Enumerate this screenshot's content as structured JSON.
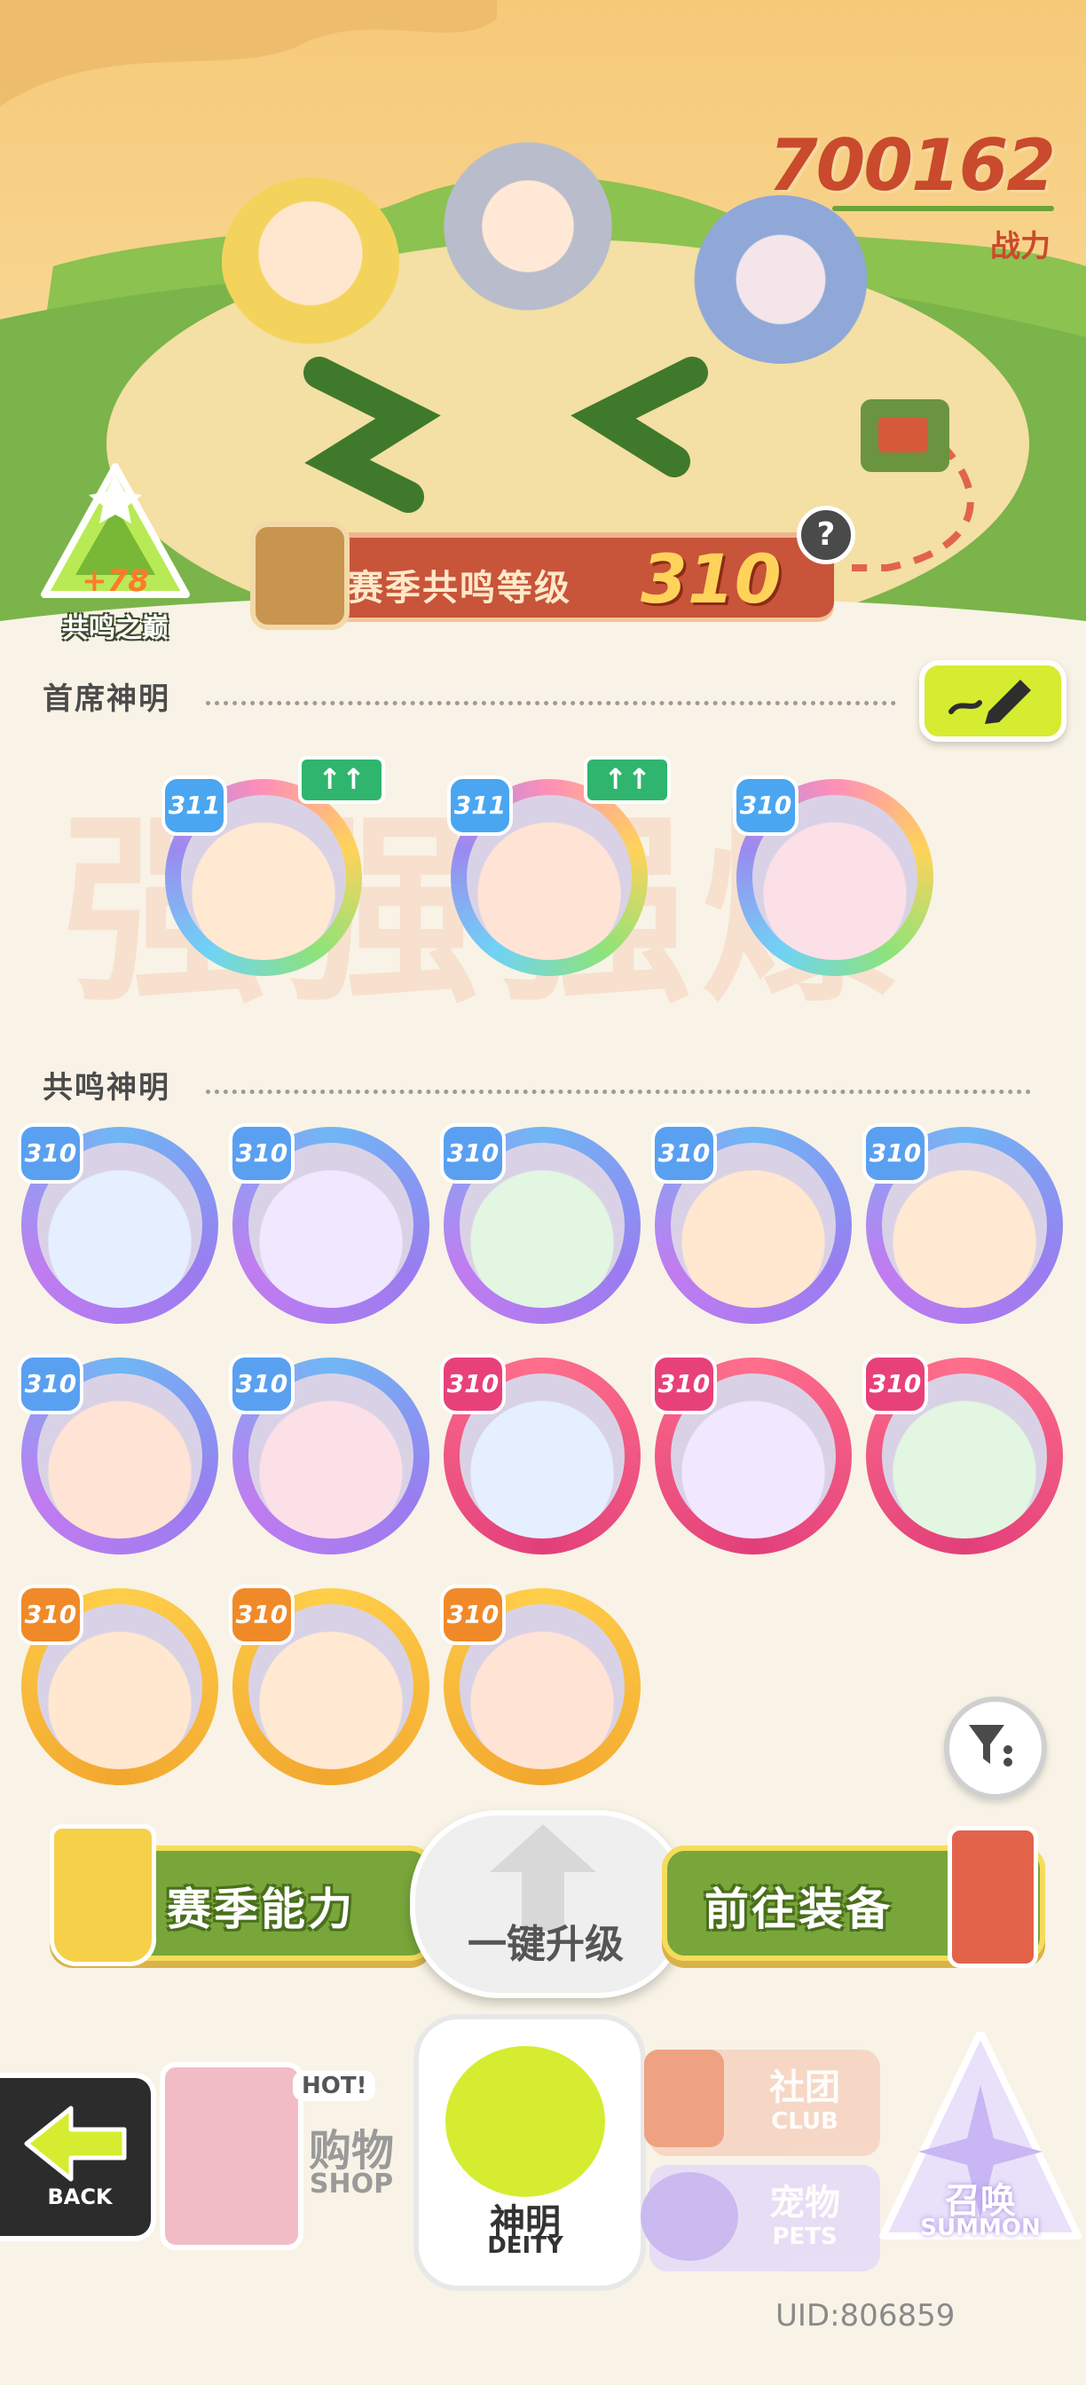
{
  "power": {
    "value": "700162",
    "label": "战力"
  },
  "peak_badge": {
    "plus": "+78",
    "label": "共鸣之巅"
  },
  "season": {
    "label": "赛季共鸣等级",
    "value": "310"
  },
  "help_icon": "question-icon",
  "sections": {
    "chief": "首席神明",
    "resonance": "共鸣神明"
  },
  "edit_icon": "pencil-icon",
  "watermark": "强强强爆",
  "chief_cards": [
    {
      "level": "311",
      "upgrade": true,
      "rarity": "rainbow"
    },
    {
      "level": "311",
      "upgrade": true,
      "rarity": "rainbow"
    },
    {
      "level": "310",
      "upgrade": false,
      "rarity": "rainbow"
    }
  ],
  "upgrade_icon_text": "↑↑",
  "resonance_cards": [
    {
      "level": "310",
      "rarity": "purple"
    },
    {
      "level": "310",
      "rarity": "purple"
    },
    {
      "level": "310",
      "rarity": "purple"
    },
    {
      "level": "310",
      "rarity": "purple"
    },
    {
      "level": "310",
      "rarity": "purple"
    },
    {
      "level": "310",
      "rarity": "purple"
    },
    {
      "level": "310",
      "rarity": "purple"
    },
    {
      "level": "310",
      "rarity": "red"
    },
    {
      "level": "310",
      "rarity": "red"
    },
    {
      "level": "310",
      "rarity": "red"
    },
    {
      "level": "310",
      "rarity": "gold"
    },
    {
      "level": "310",
      "rarity": "gold"
    },
    {
      "level": "310",
      "rarity": "gold"
    }
  ],
  "filter_icon": "filter-icon",
  "actions": {
    "season_ability": "赛季能力",
    "one_click": "一键升级",
    "equip": "前往装备"
  },
  "nav": {
    "back_label": "BACK",
    "shop_cn": "购物",
    "shop_en": "SHOP",
    "hot": "HOT!",
    "deity_cn": "神明",
    "deity_en": "DEITY",
    "club_cn": "社团",
    "club_en": "CLUB",
    "pets_cn": "宠物",
    "pets_en": "PETS",
    "summon_cn": "召唤",
    "summon_en": "SUMMON"
  },
  "uid": "UID:806859",
  "colors": {
    "purple_ring": "#8f6cf0",
    "red_ring": "#e54f86",
    "gold_ring": "#f2b437",
    "level_purple": "#5aa0f0",
    "level_red": "#e8417a",
    "level_gold": "#f08a28",
    "accent_green": "#78a63a"
  }
}
